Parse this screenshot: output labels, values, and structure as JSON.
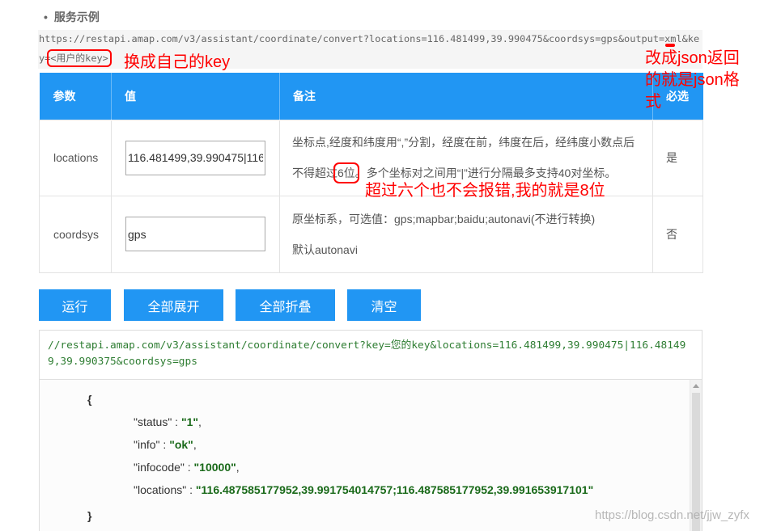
{
  "section": {
    "bullet": "•",
    "title": "服务示例"
  },
  "request_url": {
    "prefix": "https://restapi.amap.com/v3/assistant/coordinate/convert?locations=116.481499,39.990475&coordsys=gps&output=xml&key=",
    "key_placeholder": "<用户的key>"
  },
  "annotations": {
    "replace_key": "换成自己的key",
    "json_output": "改成json返回的就是json格式",
    "decimal_places": "超过六个也不会报错,我的就是8位"
  },
  "params_table": {
    "headers": {
      "param": "参数",
      "value": "值",
      "note": "备注",
      "required": "必选"
    },
    "rows": [
      {
        "name": "locations",
        "value": "116.481499,39.990475|116",
        "note_line_1": "坐标点,经度和纬度用“,”分割，经度在前，纬度在后，经纬度小数点后",
        "note_line_2_before": "不得超过",
        "note_line_2_highlight": "6位",
        "note_line_2_after": "。多个坐标对之间用“|”进行分隔最多支持40对坐标。",
        "required": "是"
      },
      {
        "name": "coordsys",
        "value": "gps",
        "note_line_1": "原坐标系，可选值：gps;mapbar;baidu;autonavi(不进行转换)",
        "note_line_2": "默认autonavi",
        "required": "否"
      }
    ]
  },
  "buttons": {
    "run": "运行",
    "expand_all": "全部展开",
    "collapse_all": "全部折叠",
    "clear": "清空"
  },
  "result": {
    "url": "//restapi.amap.com/v3/assistant/coordinate/convert?key=您的key&locations=116.481499,39.990475|116.481499,39.990375&coordsys=gps",
    "open_brace": "{",
    "lines": [
      {
        "key": "\"status\"",
        "sep": " : ",
        "value": "\"1\"",
        "trail": ","
      },
      {
        "key": "\"info\"",
        "sep": " : ",
        "value": "\"ok\"",
        "trail": ","
      },
      {
        "key": "\"infocode\"",
        "sep": " : ",
        "value": "\"10000\"",
        "trail": ","
      },
      {
        "key": "\"locations\"",
        "sep": " : ",
        "value": "\"116.487585177952,39.991754014757;116.487585177952,39.991653917101\""
      }
    ],
    "close_brace": "}"
  },
  "watermark": "https://blog.csdn.net/jjw_zyfx",
  "icons": {
    "scroll_up": "triangle-up-icon"
  },
  "colors": {
    "accent": "#2196f3",
    "annotation": "#ff0000",
    "result_url": "#2e7d32",
    "json_value": "#1a6a1a"
  }
}
